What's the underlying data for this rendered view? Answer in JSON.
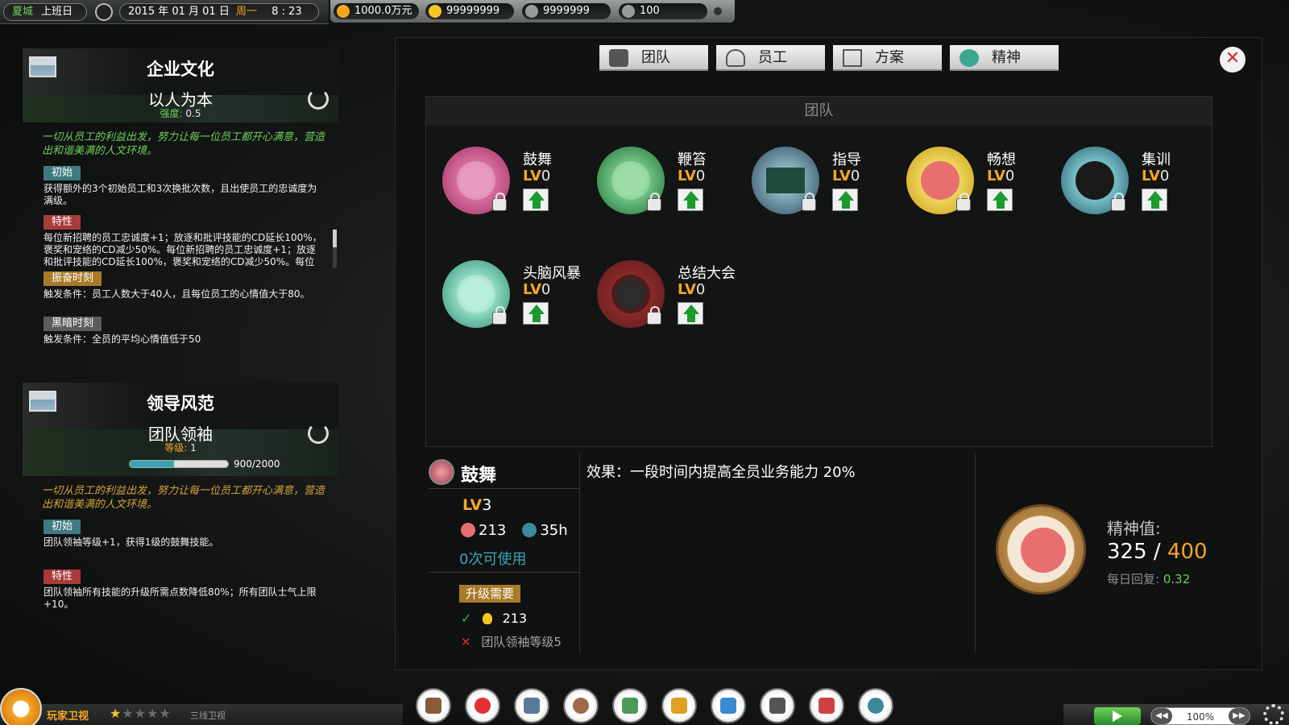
{
  "topbar": {
    "location": "夏城",
    "status": "上班日",
    "date": "2015 年 01 月 01 日",
    "weekday": "周一",
    "time": "8 : 23",
    "resources": [
      {
        "value": "1000.0万元",
        "icon": "coin-icon",
        "color": "#f5a623"
      },
      {
        "value": "99999999",
        "icon": "bulb-icon",
        "color": "#f5c623"
      },
      {
        "value": "9999999",
        "icon": "megaphone-icon",
        "color": "#9a9c9b"
      },
      {
        "value": "100",
        "icon": "server-icon",
        "color": "#9a9c9b"
      }
    ]
  },
  "left": {
    "culture": {
      "title": "企业文化",
      "name": "以人为本",
      "strength_label": "强度:",
      "strength_value": "0.5",
      "desc": "一切从员工的利益出发，努力让每一位员工都开心满意，营造出和谐美满的人文环境。",
      "initial_tag": "初始",
      "initial_text": "获得额外的3个初始员工和3次换批次数，且出使员工的忠诚度为满级。",
      "trait_tag": "特性",
      "trait_text": "每位新招聘的员工忠诚度+1；放逐和批评技能的CD延长100%，褒奖和宠络的CD减少50%。每位新招聘的员工忠诚度+1；放逐和批评技能的CD延长100%，褒奖和宠络的CD减少50%。每位新招聘的员工忠诚度+1；放逐和批评技能的CD延长",
      "vigor_tag": "振奋时刻",
      "vigor_text": "触发条件：员工人数大于40人，且每位员工的心情值大于80。",
      "dark_tag": "黑暗时刻",
      "dark_text": "触发条件：全员的平均心情值低于50"
    },
    "leadership": {
      "title": "领导风范",
      "name": "团队领袖",
      "level_label": "等级:",
      "level_value": "1",
      "progress_text": "900/2000",
      "progress_fraction": 0.45,
      "desc": "一切从员工的利益出发，努力让每一位员工都开心满意，营造出和谐美满的人文环境。",
      "initial_tag": "初始",
      "initial_text": "团队领袖等级+1，获得1级的鼓舞技能。",
      "trait_tag": "特性",
      "trait_text": "团队领袖所有技能的升级所需点数降低80%；所有团队士气上限+10。"
    }
  },
  "dialog": {
    "tabs": [
      {
        "label": "团队",
        "icon": "team-icon"
      },
      {
        "label": "员工",
        "icon": "employee-icon"
      },
      {
        "label": "方案",
        "icon": "plan-icon"
      },
      {
        "label": "精神",
        "icon": "brain-icon"
      }
    ],
    "close_label": "✕",
    "grid_title": "团队",
    "lv_prefix": "LV",
    "skills": [
      {
        "name": "鼓舞",
        "level": "0",
        "color": "#b83a72",
        "icon": "fist-icon"
      },
      {
        "name": "鞭笞",
        "level": "0",
        "color": "#2f8a4a",
        "icon": "whip-icon"
      },
      {
        "name": "指导",
        "level": "0",
        "color": "#3a6a7a",
        "icon": "blackboard-icon"
      },
      {
        "name": "畅想",
        "level": "0",
        "color": "#e0b020",
        "icon": "dream-icon"
      },
      {
        "name": "集训",
        "level": "0",
        "color": "#2a7a8a",
        "icon": "training-icon"
      },
      {
        "name": "头脑风暴",
        "level": "0",
        "color": "#3aa890",
        "icon": "brainstorm-icon"
      },
      {
        "name": "总结大会",
        "level": "0",
        "color": "#8a2a2a",
        "icon": "meeting-icon"
      }
    ],
    "detail": {
      "name": "鼓舞",
      "level": "3",
      "cost_points": "213",
      "cooldown": "35h",
      "uses": "0次可使用",
      "effect": "效果：一段时间内提高全员业务能力 20%",
      "req_tag": "升级需要",
      "req1": "213",
      "req2": "团队领袖等级5",
      "spirit_label": "精神值:",
      "spirit_current": "325",
      "spirit_sep": " / ",
      "spirit_max": "400",
      "daily_label": "每日回复:",
      "daily_value": "0.32"
    }
  },
  "bottom": {
    "channel": "玩家卫视",
    "stars_on": "★",
    "stars_off": "★★★★",
    "tier": "三线卫视",
    "dock": [
      {
        "icon": "tv-icon",
        "color": "#8a5a3a"
      },
      {
        "icon": "heart-icon",
        "color": "#e03030"
      },
      {
        "icon": "list-icon",
        "color": "#5a7a9a"
      },
      {
        "icon": "people-icon",
        "color": "#a06a4a"
      },
      {
        "icon": "cart-icon",
        "color": "#4a9a5a"
      },
      {
        "icon": "crane-icon",
        "color": "#e0a020"
      },
      {
        "icon": "chart-icon",
        "color": "#3a8ad0"
      },
      {
        "icon": "news-icon",
        "color": "#555555"
      },
      {
        "icon": "map-icon",
        "color": "#d04040"
      },
      {
        "icon": "globe-icon",
        "color": "#3a8a9a"
      }
    ],
    "speed": "100%"
  }
}
